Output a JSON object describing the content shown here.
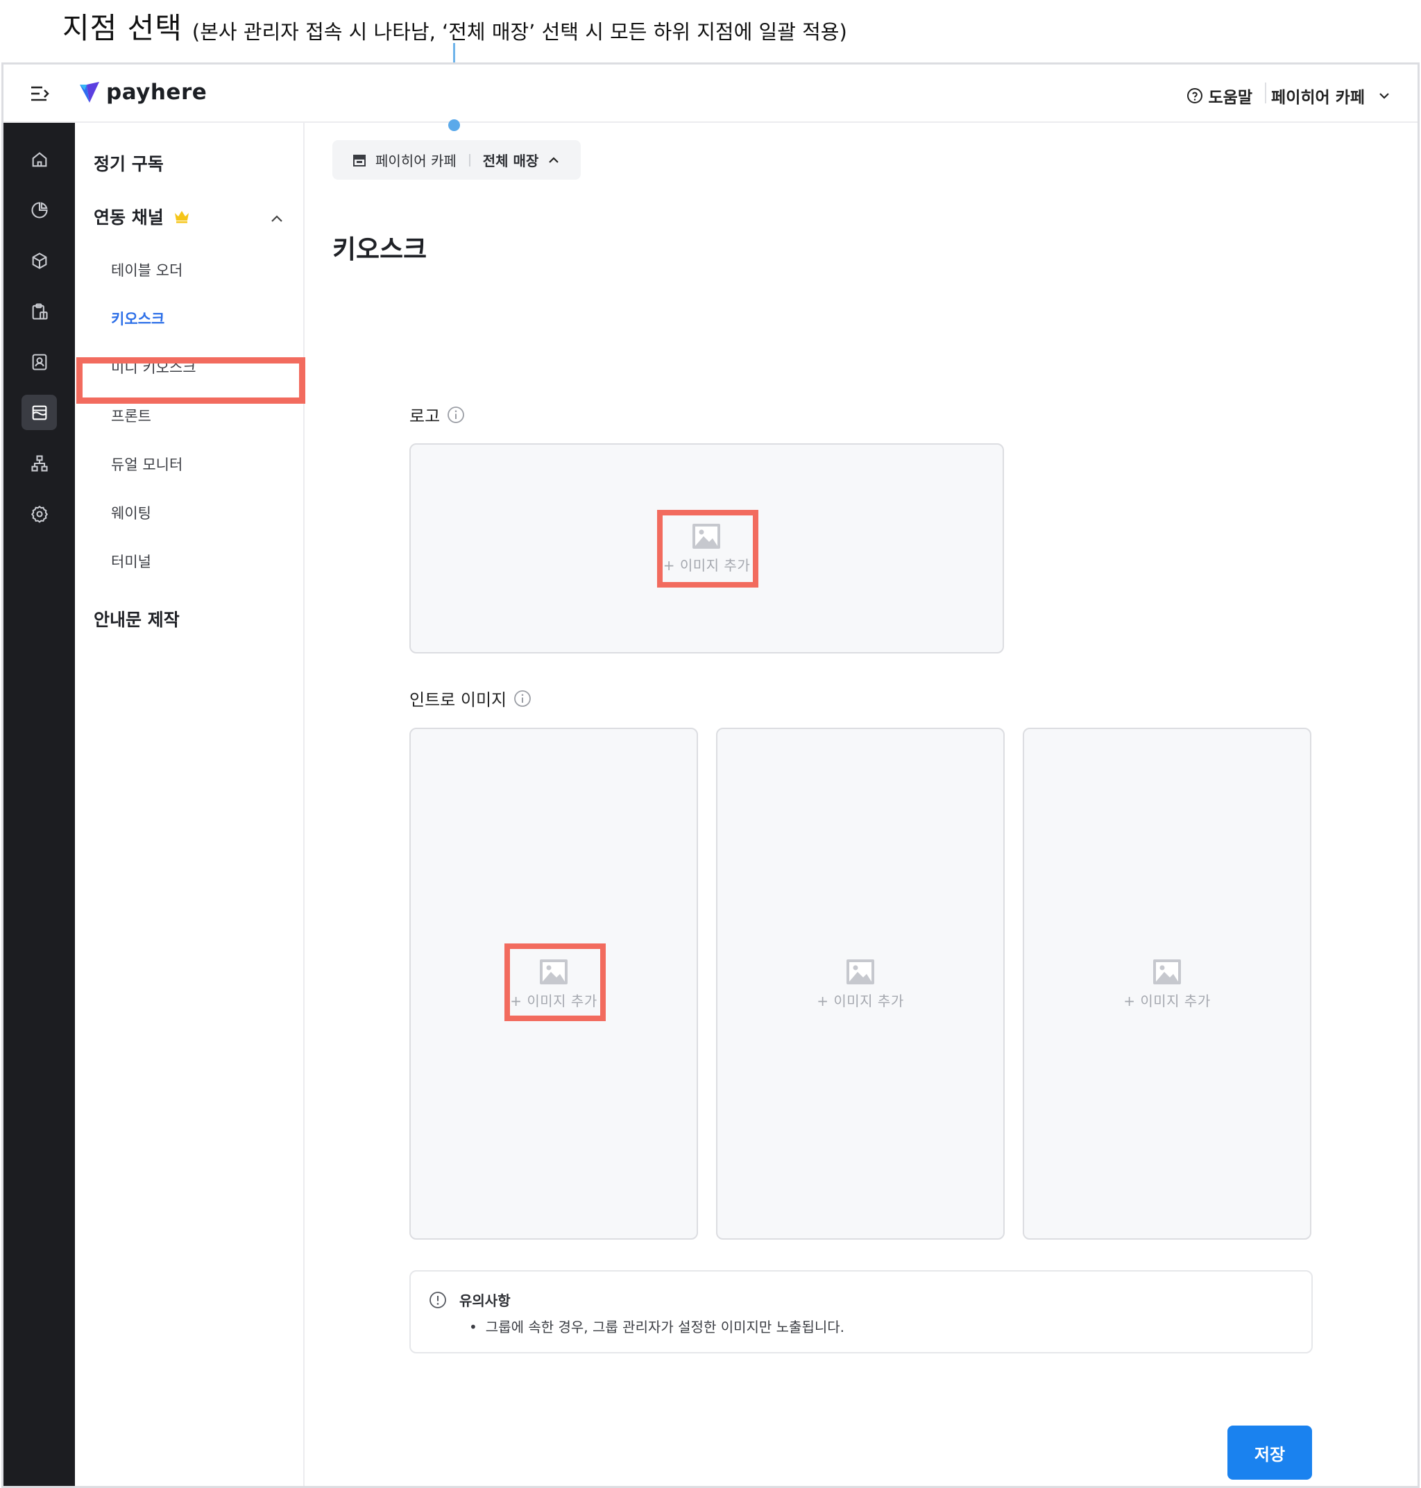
{
  "annotation": {
    "title": "지점 선택",
    "note": "(본사 관리자 접속 시 나타남, ‘전체 매장’ 선택 시 모든 하위 지점에 일괄 적용)"
  },
  "header": {
    "logo": "payhere",
    "help_label": "도움말",
    "store_name": "페이히어 카페"
  },
  "rail": {
    "icons": [
      "home-icon",
      "chart-icon",
      "box-icon",
      "clipboard-icon",
      "contact-icon",
      "store-icon",
      "org-chart-icon",
      "settings-icon"
    ],
    "active": "store-icon"
  },
  "subnav": {
    "subscription": "정기 구독",
    "channels": "연동 채널",
    "channels_items": [
      "테이블 오더",
      "키오스크",
      "미니 키오스크",
      "프론트",
      "듀얼 모니터",
      "웨이팅",
      "터미널"
    ],
    "active_item": "키오스크",
    "notice_make": "안내문 제작"
  },
  "branch": {
    "brand": "페이히어 카페",
    "selected": "전체 매장"
  },
  "page": {
    "title": "키오스크",
    "logo_label": "로고",
    "intro_label": "인트로 이미지",
    "add_image": "+ 이미지 추가",
    "notice_title": "유의사항",
    "notice_text": "그룹에 속한 경우, 그룹 관리자가 설정한 이미지만 노출됩니다.",
    "save": "저장"
  },
  "colors": {
    "accent": "#1a82ef",
    "active_nav": "#2d6fe8",
    "highlight": "#f26b5e",
    "rail_bg": "#1c1d21",
    "annotation_line": "#6fb4ea"
  }
}
